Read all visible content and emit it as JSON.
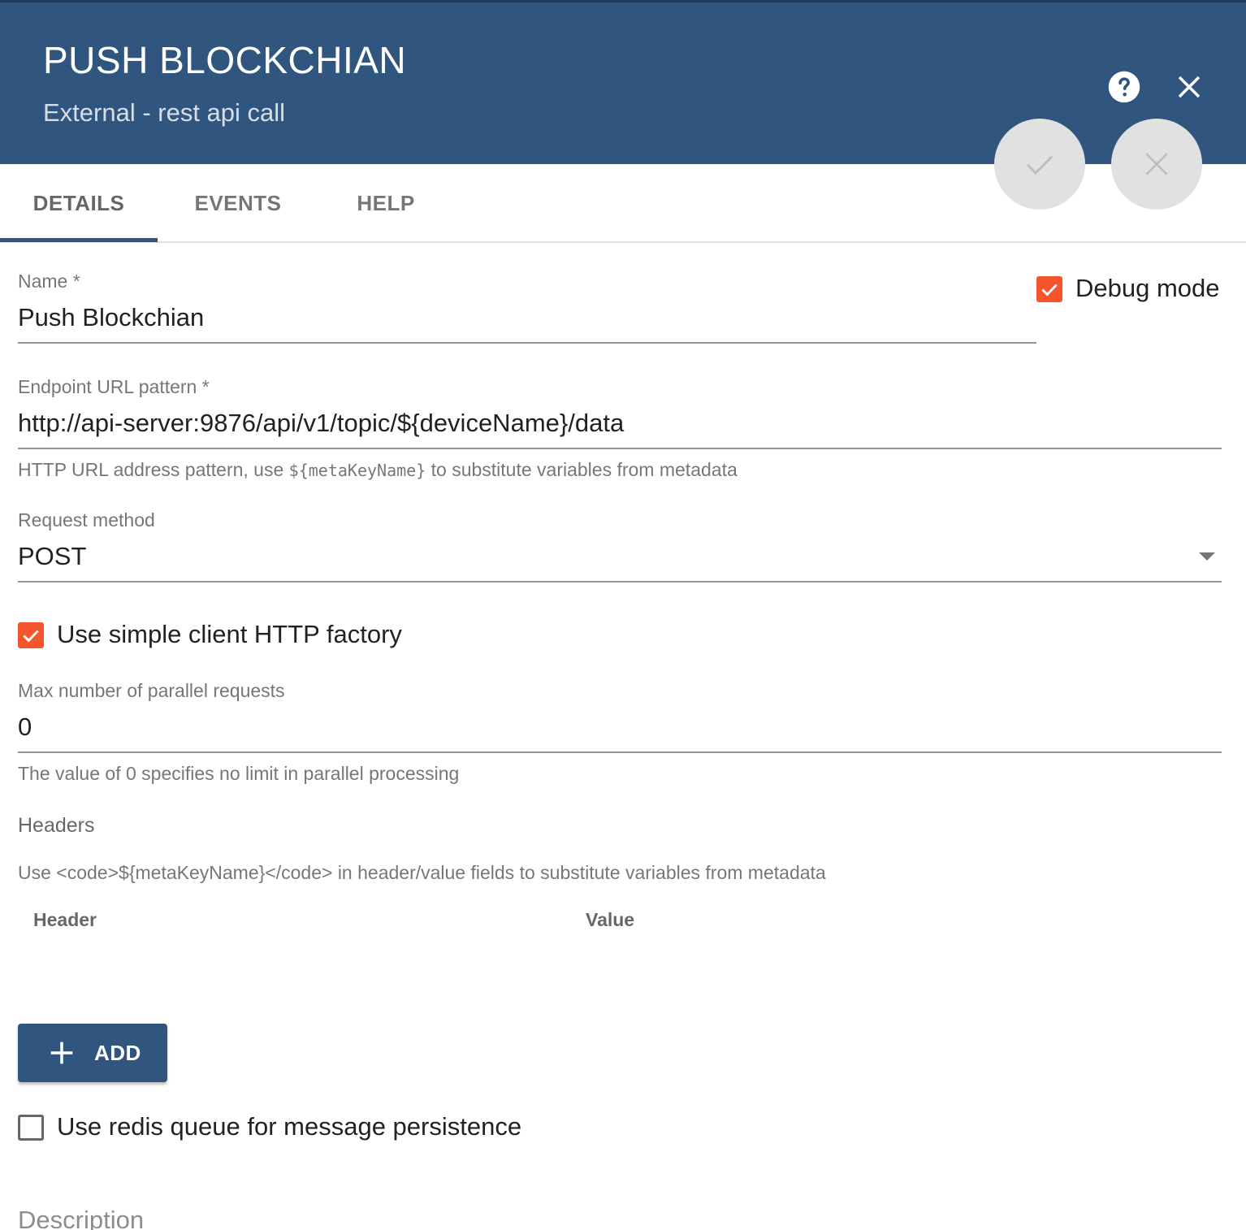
{
  "header": {
    "title": "PUSH BLOCKCHIAN",
    "subtitle": "External - rest api call",
    "background_color": "#305680",
    "help_icon": "help-circle-icon",
    "close_icon": "close-icon"
  },
  "actions": {
    "apply_icon": "check-icon",
    "cancel_icon": "close-icon"
  },
  "tabs": [
    {
      "label": "DETAILS",
      "active": true
    },
    {
      "label": "EVENTS",
      "active": false
    },
    {
      "label": "HELP",
      "active": false
    }
  ],
  "form": {
    "name": {
      "label": "Name *",
      "value": "Push Blockchian"
    },
    "debug_mode": {
      "label": "Debug mode",
      "checked": true
    },
    "endpoint": {
      "label": "Endpoint URL pattern *",
      "value": "http://api-server:9876/api/v1/topic/${deviceName}/data",
      "hint_prefix": "HTTP URL address pattern, use ",
      "hint_code": "${metaKeyName}",
      "hint_suffix": " to substitute variables from metadata"
    },
    "request_method": {
      "label": "Request method",
      "value": "POST"
    },
    "simple_client": {
      "label": "Use simple client HTTP factory",
      "checked": true
    },
    "max_parallel": {
      "label": "Max number of parallel requests",
      "value": "0",
      "hint": "The value of 0 specifies no limit in parallel processing"
    },
    "headers": {
      "title": "Headers",
      "hint": "Use <code>${metaKeyName}</code> in header/value fields to substitute variables from metadata",
      "columns": [
        "Header",
        "Value"
      ],
      "add_label": "ADD"
    },
    "redis_queue": {
      "label": "Use redis queue for message persistence",
      "checked": false
    },
    "description": {
      "label": "Description"
    }
  },
  "colors": {
    "accent": "#f4552c",
    "primary": "#305680"
  }
}
